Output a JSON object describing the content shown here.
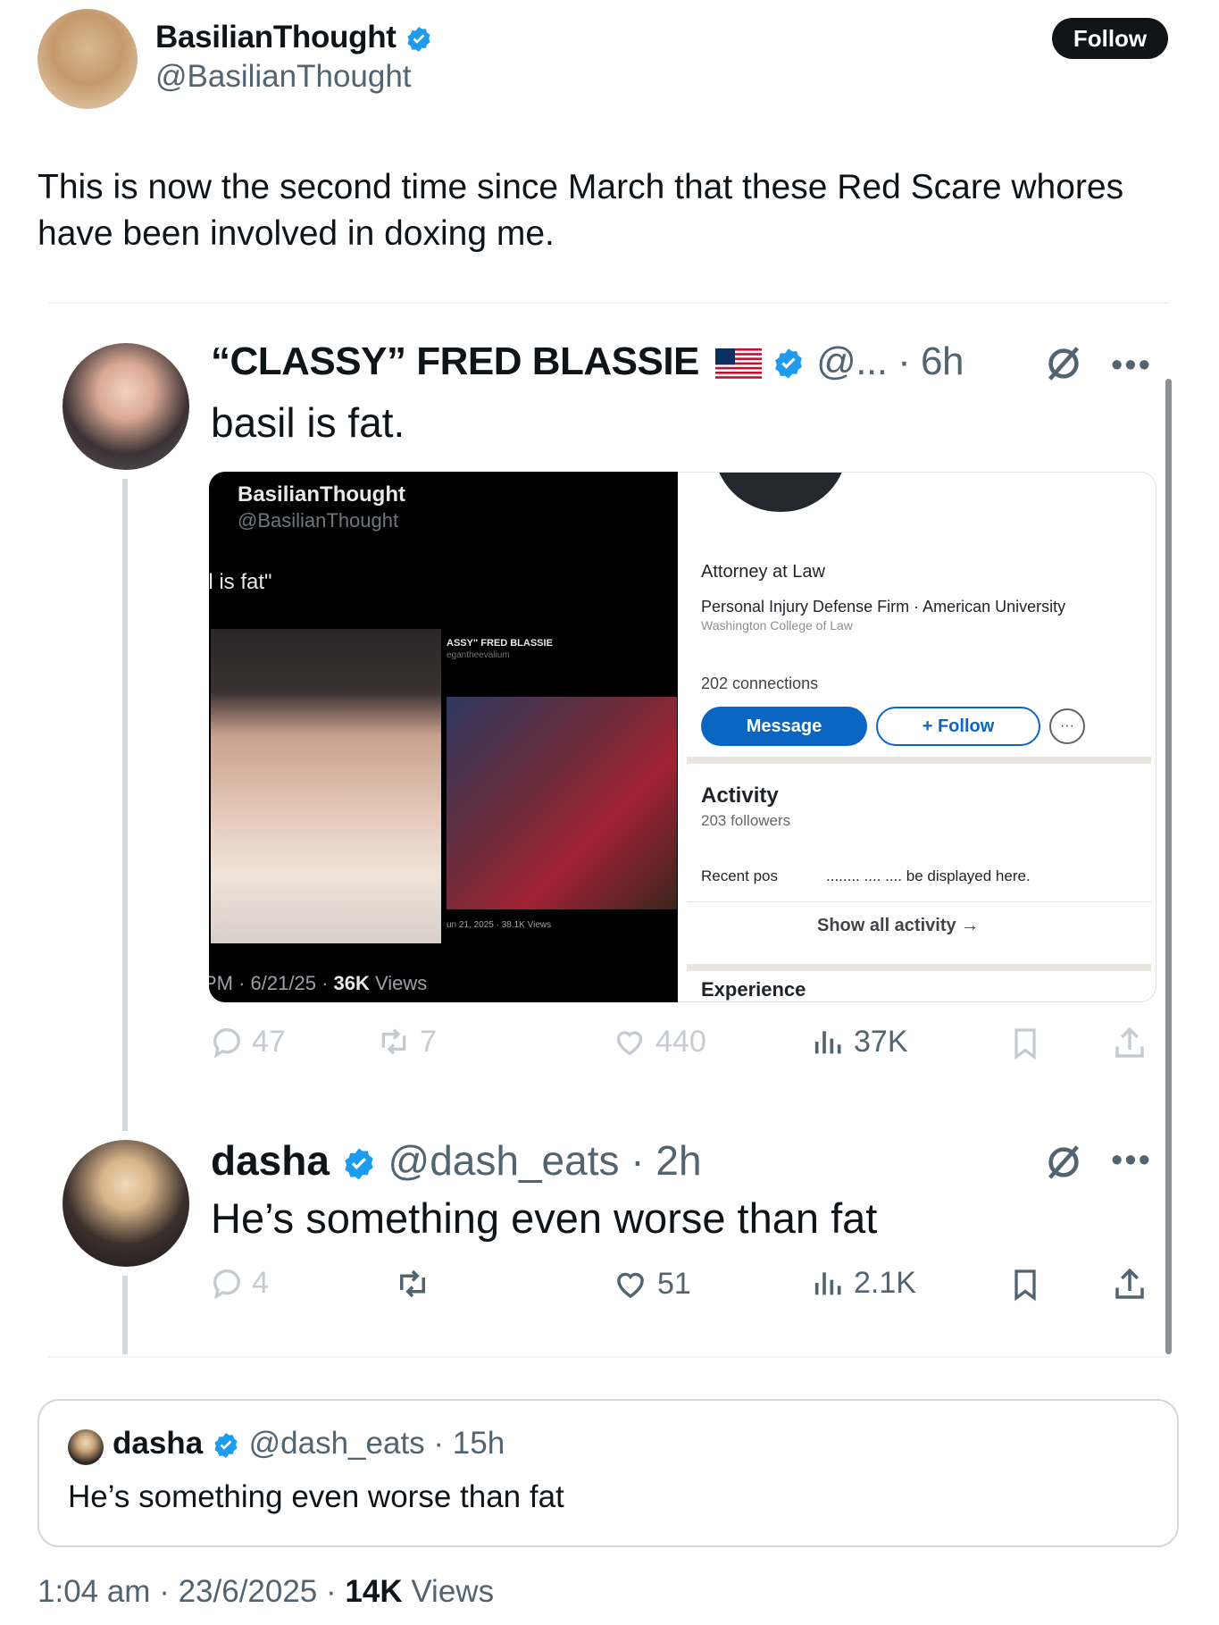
{
  "author": {
    "name": "BasilianThought",
    "handle": "@BasilianThought",
    "follow_label": "Follow"
  },
  "tweet": {
    "text": "This is now the second time since March that these Red Scare whores have been involved in doxing me."
  },
  "embedded_post": {
    "name": "“CLASSY” FRED BLASSIE",
    "handle_time": "@... · 6h",
    "text": "basil is fat.",
    "media_left": {
      "name": "BasilianThought",
      "handle": "@BasilianThought",
      "quote": "il is fat\"",
      "mini_name": "ASSY\" FRED BLASSIE",
      "mini_handle": "egantheevalium",
      "mini_footer": "un 21, 2025 · 38.1K Views",
      "footer_prefix": "PM · 6/21/25 · ",
      "footer_views": "36K",
      "footer_suffix": " Views"
    },
    "media_right": {
      "title": "Attorney at Law",
      "firm": "Personal Injury Defense Firm · American University",
      "college": "Washington College of Law",
      "connections": "202 connections",
      "message_label": "Message",
      "follow_label": "+ Follow",
      "more_label": "···",
      "activity_heading": "Activity",
      "followers": "203 followers",
      "recent": "Recent pos",
      "displayed": "........ .... .... be displayed here.",
      "show_all": "Show all activity →",
      "experience": "Experience"
    },
    "stats": {
      "replies": "47",
      "reposts": "7",
      "likes": "440",
      "views": "37K"
    }
  },
  "reply": {
    "name": "dasha",
    "handle_time": "@dash_eats · 2h",
    "text": "He’s something even worse than fat",
    "stats": {
      "replies": "4",
      "likes": "51",
      "views": "2.1K"
    }
  },
  "quoted": {
    "name": "dasha",
    "handle_time": "@dash_eats · 15h",
    "text": "He’s something even worse than fat"
  },
  "meta": {
    "time_date": "1:04 am · 23/6/2025 · ",
    "views_count": "14K",
    "views_label": " Views"
  },
  "colors": {
    "verified": "#1d9bf0",
    "linkedin_blue": "#0a66c2",
    "text": "#0f1419",
    "muted": "#536471"
  },
  "icons": [
    "verified-badge-icon",
    "us-flag-icon",
    "grok-icon",
    "more-icon",
    "reply-icon",
    "repost-icon",
    "like-icon",
    "views-icon",
    "bookmark-icon",
    "share-icon"
  ]
}
